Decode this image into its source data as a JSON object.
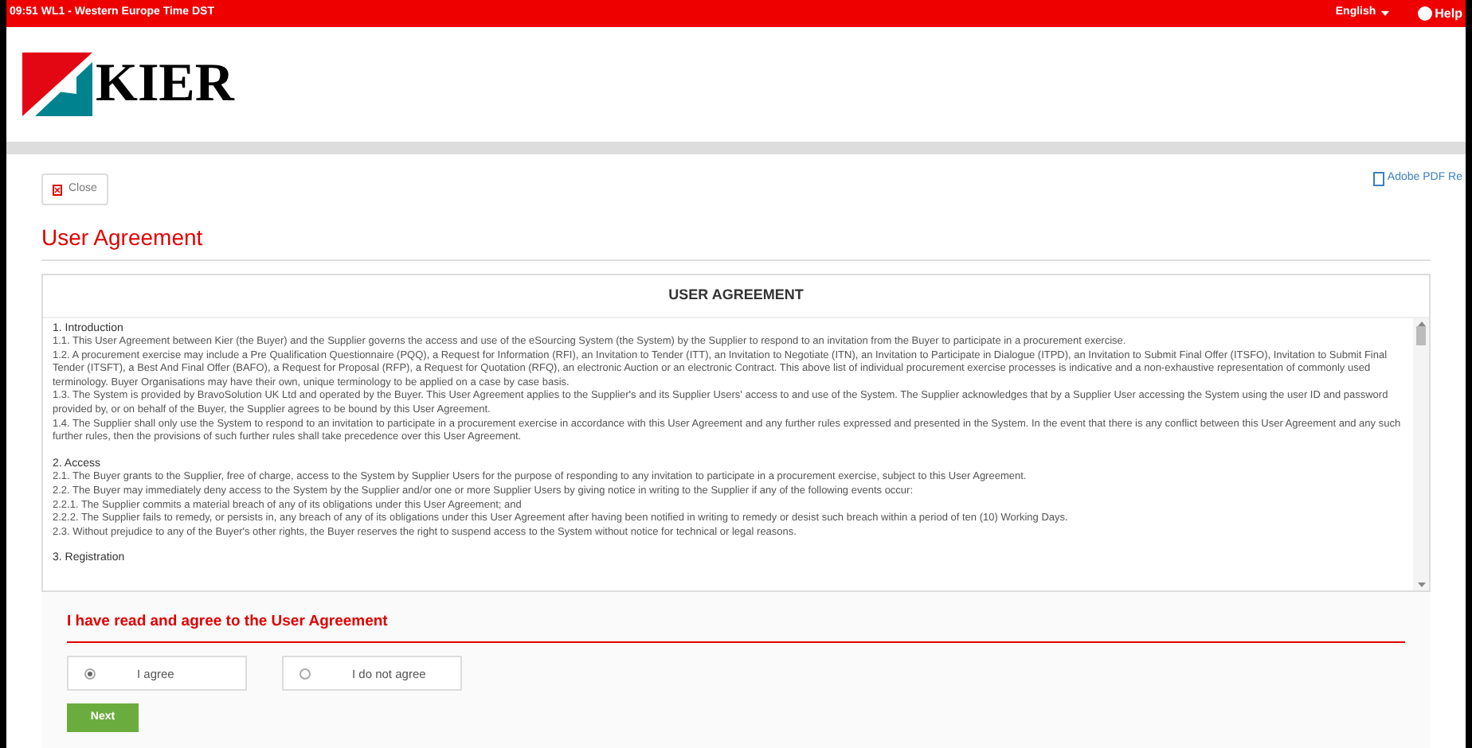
{
  "header": {
    "status": "09:51 WL1 - Western Europe Time DST",
    "language": "English",
    "help": "Help"
  },
  "logo": {
    "text": "KIER"
  },
  "toolbar": {
    "close": "Close",
    "pdf_link": "Adobe PDF Re"
  },
  "page_title": "User Agreement",
  "agreement": {
    "heading": "USER AGREEMENT",
    "sections": [
      {
        "title": "1. Introduction",
        "paragraphs": [
          "1.1. This User Agreement between Kier (the Buyer) and the Supplier governs the access and use of the eSourcing System (the System) by the Supplier to respond to an invitation from the Buyer to participate in a procurement exercise.",
          "1.2. A procurement exercise may include a Pre Qualification Questionnaire (PQQ), a Request for Information (RFI), an Invitation to Tender (ITT), an Invitation to Negotiate (ITN), an Invitation to Participate in Dialogue (ITPD), an Invitation to Submit Final Offer (ITSFO), Invitation to Submit Final Tender (ITSFT), a Best And Final Offer (BAFO), a Request for Proposal (RFP), a Request for Quotation (RFQ), an electronic Auction or an electronic Contract. This above list of individual procurement exercise processes is indicative and a non-exhaustive representation of commonly used terminology. Buyer Organisations may have their own, unique terminology to be applied on a case by case basis.",
          "1.3. The System is provided by BravoSolution UK Ltd and operated by the Buyer. This User Agreement applies to the Supplier's and its Supplier Users' access to and use of the System. The Supplier acknowledges that by a Supplier User accessing the System using the user ID and password provided by, or on behalf of the Buyer, the Supplier agrees to be bound by this User Agreement.",
          "1.4. The Supplier shall only use the System to respond to an invitation to participate in a procurement exercise in accordance with this User Agreement and any further rules expressed and presented in the System. In the event that there is any conflict between this User Agreement and any such further rules, then the provisions of such further rules shall take precedence over this User Agreement."
        ]
      },
      {
        "title": "2. Access",
        "paragraphs": [
          "2.1. The Buyer grants to the Supplier, free of charge, access to the System by Supplier Users for the purpose of responding to any invitation to participate in a procurement exercise, subject to this User Agreement.",
          "2.2. The Buyer may immediately deny access to the System by the Supplier and/or one or more Supplier Users by giving notice in writing to the Supplier if any of the following events occur:",
          "2.2.1. The Supplier commits a material breach of any of its obligations under this User Agreement; and",
          "2.2.2. The Supplier fails to remedy, or persists in, any breach of any of its obligations under this User Agreement after having been notified in writing to remedy or desist such breach within a period of ten (10) Working Days.",
          "2.3. Without prejudice to any of the Buyer's other rights, the Buyer reserves the right to suspend access to the System without notice for technical or legal reasons."
        ]
      },
      {
        "title": "3. Registration"
      }
    ]
  },
  "consent": {
    "heading": "I have read and agree to the User Agreement",
    "options": [
      {
        "label": "I agree",
        "selected": true
      },
      {
        "label": "I do not agree",
        "selected": false
      }
    ],
    "next": "Next"
  }
}
